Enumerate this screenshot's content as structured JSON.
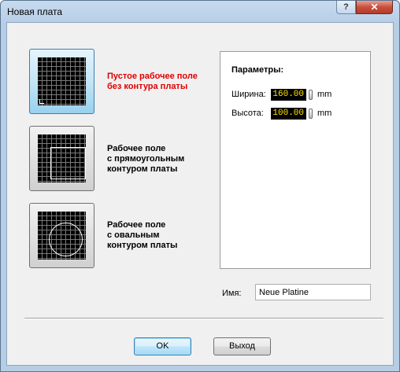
{
  "window": {
    "title": "Новая плата",
    "help_glyph": "?",
    "close_glyph": "✕"
  },
  "options": [
    {
      "label": "Пустое рабочее поле\nбез контура платы",
      "selected": true,
      "icon": "empty-grid-icon"
    },
    {
      "label": "Рабочее поле\nс прямоугольным\nконтуром платы",
      "selected": false,
      "icon": "rectangle-outline-grid-icon"
    },
    {
      "label": "Рабочее поле\nс овальным\nконтуром платы",
      "selected": false,
      "icon": "oval-outline-grid-icon"
    }
  ],
  "params": {
    "title": "Параметры:",
    "width_label": "Ширина:",
    "width_value": "160.00",
    "width_unit": "mm",
    "height_label": "Высота:",
    "height_value": "100.00",
    "height_unit": "mm"
  },
  "name": {
    "label": "Имя:",
    "value": "Neue Platine"
  },
  "buttons": {
    "ok": "OK",
    "exit": "Выход"
  },
  "colors": {
    "selected_label": "#e00000",
    "value_text": "#ffe400",
    "value_bg": "#000000"
  }
}
